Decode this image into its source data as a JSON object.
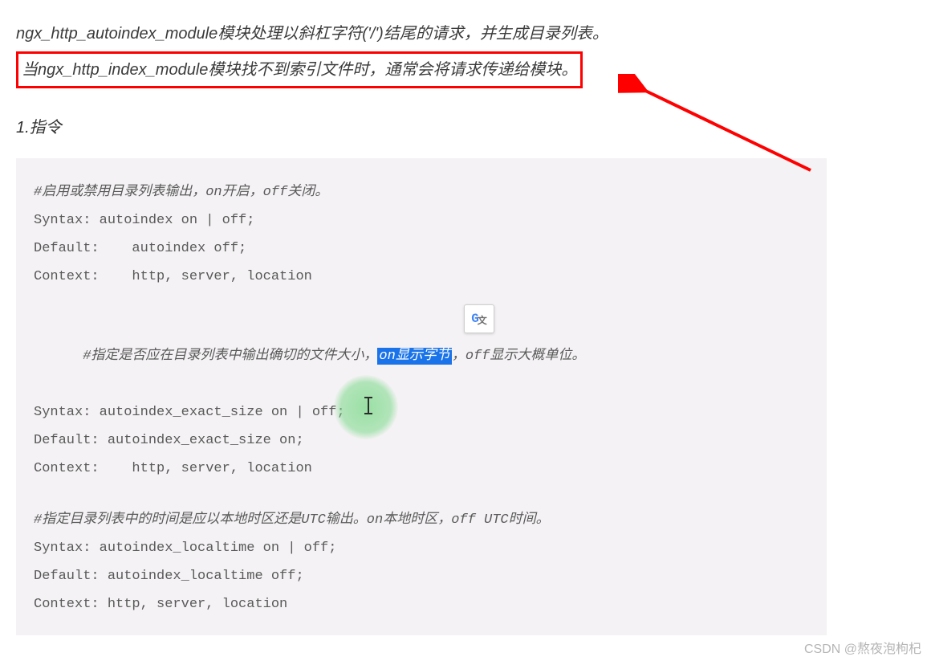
{
  "intro": {
    "line1": "ngx_http_autoindex_module模块处理以斜杠字符('/')结尾的请求，并生成目录列表。",
    "line2": "当ngx_http_index_module模块找不到索引文件时，通常会将请求传递给模块。"
  },
  "section_title": "1.指令",
  "code": {
    "g1": {
      "comment": "#启用或禁用目录列表输出，on开启，off关闭。",
      "syntax": "Syntax: autoindex on | off;",
      "default": "Default:    autoindex off;",
      "context": "Context:    http, server, location"
    },
    "g2": {
      "comment_a": "#指定是否应在目录列表中输出确切的文件大小，",
      "comment_hl": "on显示字节",
      "comment_b": "，off显示大概单位。",
      "syntax": "Syntax: autoindex_exact_size on | off;",
      "default": "Default: autoindex_exact_size on;",
      "context": "Context:    http, server, location"
    },
    "g3": {
      "comment": "#指定目录列表中的时间是应以本地时区还是UTC输出。on本地时区，off UTC时间。",
      "syntax": "Syntax: autoindex_localtime on | off;",
      "default": "Default: autoindex_localtime off;",
      "context": "Context: http, server, location"
    }
  },
  "translate_badge": {
    "main": "G",
    "sub": "文"
  },
  "watermark": "CSDN @熬夜泡枸杞"
}
